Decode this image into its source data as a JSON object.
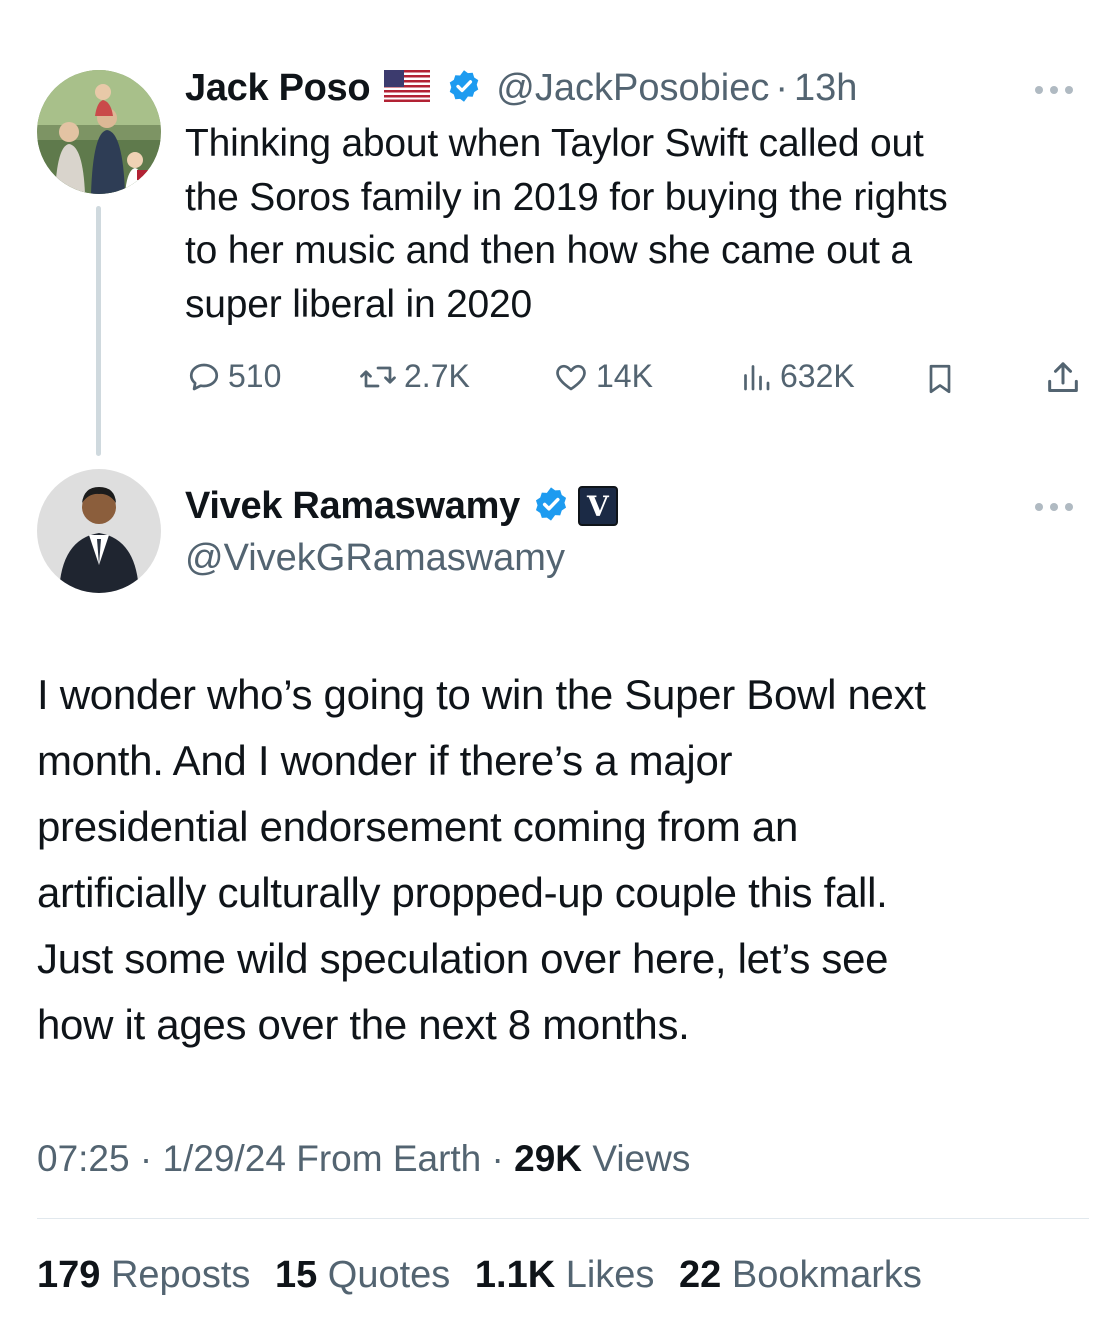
{
  "colors": {
    "text": "#0f1419",
    "muted": "#536471",
    "verified": "#1d9bf0",
    "thread_line": "#cfd9de"
  },
  "parent_tweet": {
    "author_name": "Jack Poso",
    "flag_icon": "us-flag-icon",
    "handle": "@JackPosobiec",
    "separator": "·",
    "time_ago": "13h",
    "text": "Thinking about when Taylor Swift called out the Soros family in 2019 for buying the rights to her music and then how she came out a super liberal in 2020",
    "lines": [
      "Thinking about when Taylor Swift called out",
      "the Soros family in 2019 for buying the rights",
      "to her music and then how she came out a",
      "super liberal in 2020"
    ],
    "actions": {
      "replies": "510",
      "reposts": "2.7K",
      "likes": "14K",
      "views": "632K"
    }
  },
  "main_tweet": {
    "author_name": "Vivek Ramaswamy",
    "handle": "@VivekGRamaswamy",
    "affiliate_badge_letter": "V",
    "lines": [
      "I wonder who’s going to win the Super Bowl next",
      "month. And I wonder if there’s a major",
      "presidential endorsement coming from an",
      "artificially culturally propped-up couple this fall.",
      "Just some wild speculation over here, let’s see",
      "how it ages over the next 8 months."
    ],
    "meta": {
      "time": "07:25",
      "sep1": "·",
      "date_source": "1/29/24 From Earth",
      "sep2": "·",
      "views_count": "29K",
      "views_label": "Views"
    },
    "stats": {
      "reposts_count": "179",
      "reposts_label": "Reposts",
      "quotes_count": "15",
      "quotes_label": "Quotes",
      "likes_count": "1.1K",
      "likes_label": "Likes",
      "bookmarks_count": "22",
      "bookmarks_label": "Bookmarks"
    }
  }
}
